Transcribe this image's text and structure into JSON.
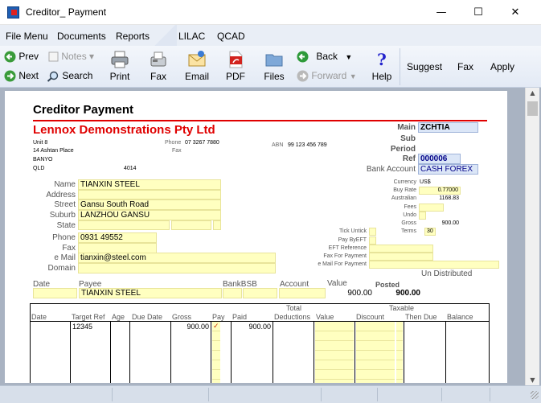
{
  "window": {
    "title": "Creditor_ Payment",
    "minimize": "—",
    "maximize": "☐",
    "close": "✕"
  },
  "menu": {
    "file": "File Menu",
    "documents": "Documents",
    "reports": "Reports",
    "lilac": "LILAC",
    "qcad": "QCAD"
  },
  "toolbar": {
    "prev": "Prev",
    "next": "Next",
    "notes": "Notes",
    "search": "Search",
    "print": "Print",
    "fax": "Fax",
    "email": "Email",
    "pdf": "PDF",
    "files": "Files",
    "back": "Back",
    "forward": "Forward",
    "help": "Help",
    "suggest": "Suggest",
    "fax2": "Fax",
    "apply": "Apply"
  },
  "doc": {
    "title": "Creditor Payment",
    "company": "Lennox Demonstrations Pty Ltd",
    "addr1": "Unit 8",
    "addr2": "14 Ashtan Place",
    "addr3": "BANYO",
    "state": "QLD",
    "postcode": "4014",
    "phone_label": "Phone",
    "phone": "07 3267 7880",
    "fax_label": "Fax",
    "abn_label": "ABN",
    "abn": "99 123 456 789",
    "main_label": "Main",
    "main": "ZCHTIA",
    "sub_label": "Sub",
    "period_label": "Period",
    "ref_label": "Ref",
    "ref": "000006",
    "bank_label": "Bank Account",
    "bank": "CASH FOREX",
    "name_label": "Name",
    "name": "TIANXIN STEEL",
    "address_label": "Address",
    "street_label": "Street",
    "street": "Gansu South Road",
    "suburb_label": "Suburb",
    "suburb": "LANZHOU GANSU",
    "state_label": "State",
    "phone2_label": "Phone",
    "phone2": "0931 49552",
    "fax2_label": "Fax",
    "email_label": "e Mail",
    "email": "tianxin@steel.com",
    "domain_label": "Domain",
    "currency_label": "Currency",
    "currency": "US$",
    "buyrate_label": "Buy Rate",
    "buyrate": "0.77000",
    "australian_label": "Australian",
    "australian": "1168.83",
    "fees_label": "Fees",
    "undo_label": "Undo",
    "gross_label": "Gross",
    "gross": "900.00",
    "terms_label": "Terms",
    "terms": "30",
    "tick_label": "Tick Untick",
    "paybyeft_label": "Pay ByEFT",
    "eftref_label": "EFT Reference",
    "faxpay_label": "Fax For Payment",
    "mailpay_label": "e Mail For Payment",
    "undistributed": "Un Distributed",
    "pay_hdr": {
      "date": "Date",
      "payee": "Payee",
      "bankbsb": "BankBSB",
      "account": "Account",
      "value": "Value",
      "posted": "Posted"
    },
    "pay_row": {
      "payee": "TIANXIN STEEL",
      "value": "900.00",
      "posted": "900.00"
    },
    "table_hdr": {
      "date": "Date",
      "targetref": "Target Ref",
      "age": "Age",
      "duedate": "Due Date",
      "gross": "Gross",
      "pay": "Pay",
      "paid": "Paid",
      "total": "Total",
      "deductions": "Deductions",
      "value": "Value",
      "taxable": "Taxable",
      "discount": "Discount",
      "thendue": "Then Due",
      "balance": "Balance"
    },
    "table_row": {
      "targetref": "12345",
      "gross": "900.00",
      "pay": "✓",
      "paid": "900.00"
    }
  }
}
